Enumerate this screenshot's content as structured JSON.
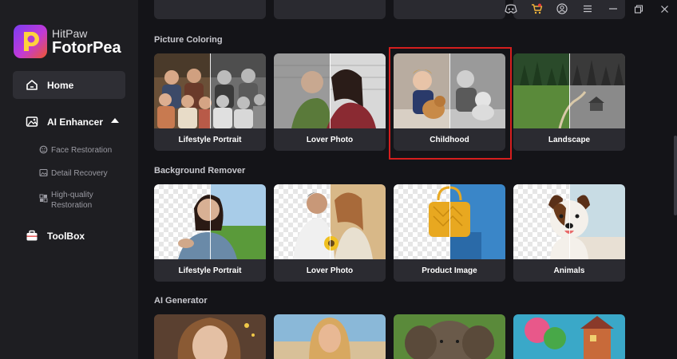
{
  "app": {
    "brand_small": "HitPaw",
    "brand_big": "FotorPea"
  },
  "sidebar": {
    "home": {
      "label": "Home",
      "icon": "home-icon"
    },
    "ai_enhancer": {
      "label": "AI Enhancer",
      "icon": "image-enhance-icon",
      "expanded": true
    },
    "sub_items": [
      {
        "label": "Face Restoration",
        "icon": "face-icon"
      },
      {
        "label": "Detail Recovery",
        "icon": "photo-icon"
      },
      {
        "label_line1": "High-quality",
        "label_line2": "Restoration",
        "icon": "grid-icon"
      }
    ],
    "toolbox": {
      "label": "ToolBox",
      "icon": "toolbox-icon"
    }
  },
  "topbar": {
    "icons": [
      "discord-icon",
      "cart-icon",
      "user-icon",
      "menu-icon",
      "minimize-icon",
      "restore-icon",
      "close-icon"
    ]
  },
  "sections": {
    "picture_coloring": {
      "title": "Picture Coloring",
      "cards": [
        "Lifestyle Portrait",
        "Lover Photo",
        "Childhood",
        "Landscape"
      ],
      "selected": "Childhood"
    },
    "background_remover": {
      "title": "Background Remover",
      "cards": [
        "Lifestyle Portrait",
        "Lover Photo",
        "Product Image",
        "Animals"
      ]
    },
    "ai_generator": {
      "title": "AI Generator"
    }
  },
  "colors": {
    "accent_highlight": "#d51e1e",
    "sidebar_bg": "#1e1e22",
    "main_bg": "#141418",
    "card_caption_bg": "#2b2b31"
  }
}
